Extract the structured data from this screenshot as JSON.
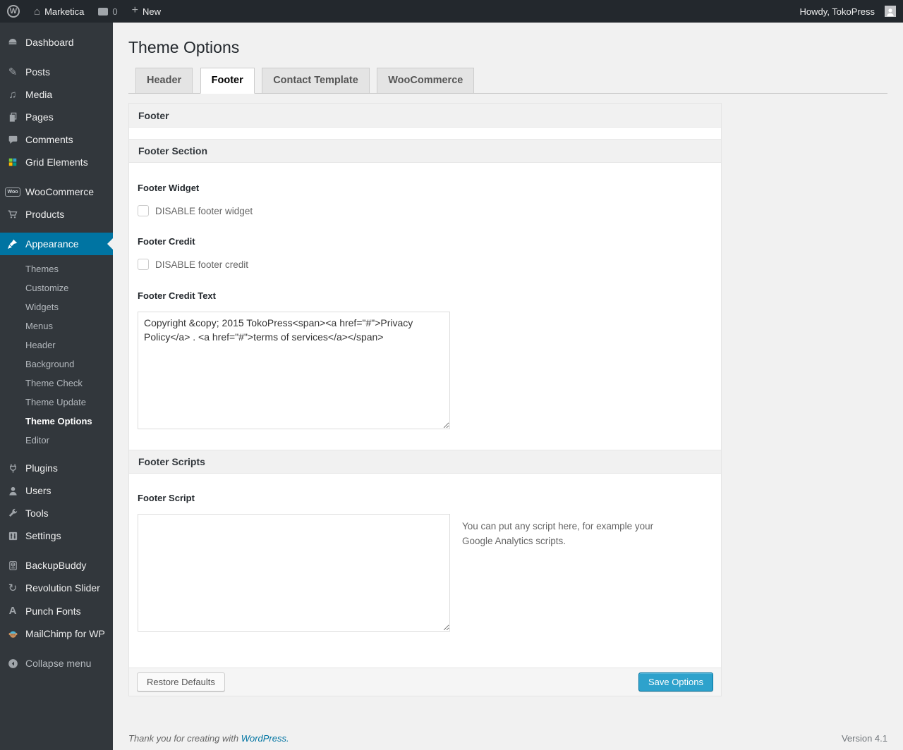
{
  "admin_bar": {
    "site_name": "Marketica",
    "comment_count": "0",
    "new_label": "New",
    "howdy_text": "Howdy, TokoPress"
  },
  "sidebar": {
    "items": [
      {
        "label": "Dashboard"
      },
      {
        "label": "Posts"
      },
      {
        "label": "Media"
      },
      {
        "label": "Pages"
      },
      {
        "label": "Comments"
      },
      {
        "label": "Grid Elements"
      },
      {
        "label": "WooCommerce"
      },
      {
        "label": "Products"
      },
      {
        "label": "Appearance"
      },
      {
        "label": "Plugins"
      },
      {
        "label": "Users"
      },
      {
        "label": "Tools"
      },
      {
        "label": "Settings"
      },
      {
        "label": "BackupBuddy"
      },
      {
        "label": "Revolution Slider"
      },
      {
        "label": "Punch Fonts"
      },
      {
        "label": "MailChimp for WP"
      },
      {
        "label": "Collapse menu"
      }
    ],
    "appearance_submenu": [
      {
        "label": "Themes"
      },
      {
        "label": "Customize"
      },
      {
        "label": "Widgets"
      },
      {
        "label": "Menus"
      },
      {
        "label": "Header"
      },
      {
        "label": "Background"
      },
      {
        "label": "Theme Check"
      },
      {
        "label": "Theme Update"
      },
      {
        "label": "Theme Options",
        "current": true
      },
      {
        "label": "Editor"
      }
    ],
    "woo_badge": "Woo",
    "punch_fonts_glyph": "A"
  },
  "page": {
    "title": "Theme Options"
  },
  "tabs": [
    {
      "label": "Header",
      "active": false
    },
    {
      "label": "Footer",
      "active": true
    },
    {
      "label": "Contact Template",
      "active": false
    },
    {
      "label": "WooCommerce",
      "active": false
    }
  ],
  "panel": {
    "group_heading": "Footer",
    "section1_heading": "Footer Section",
    "footer_widget_label": "Footer Widget",
    "footer_widget_checkbox_label": "DISABLE footer widget",
    "footer_widget_checked": false,
    "footer_credit_label": "Footer Credit",
    "footer_credit_checkbox_label": "DISABLE footer credit",
    "footer_credit_checked": false,
    "footer_credit_text_label": "Footer Credit Text",
    "footer_credit_text_value": "Copyright &copy; 2015 TokoPress<span><a href=\"#\">Privacy Policy</a> . <a href=\"#\">terms of services</a></span>",
    "section2_heading": "Footer Scripts",
    "footer_script_label": "Footer Script",
    "footer_script_value": "",
    "footer_script_description": "You can put any script here, for example your Google Analytics scripts.",
    "restore_button_label": "Restore Defaults",
    "save_button_label": "Save Options"
  },
  "footer": {
    "thanks_prefix": "Thank you for creating with ",
    "wordpress_link": "WordPress.",
    "version": "Version 4.1"
  },
  "colors": {
    "accent": "#0074a2",
    "primary_button": "#2ea2cc",
    "admin_bar_bg": "#23282d",
    "menu_bg": "#32373c",
    "page_bg": "#f1f1f1"
  }
}
